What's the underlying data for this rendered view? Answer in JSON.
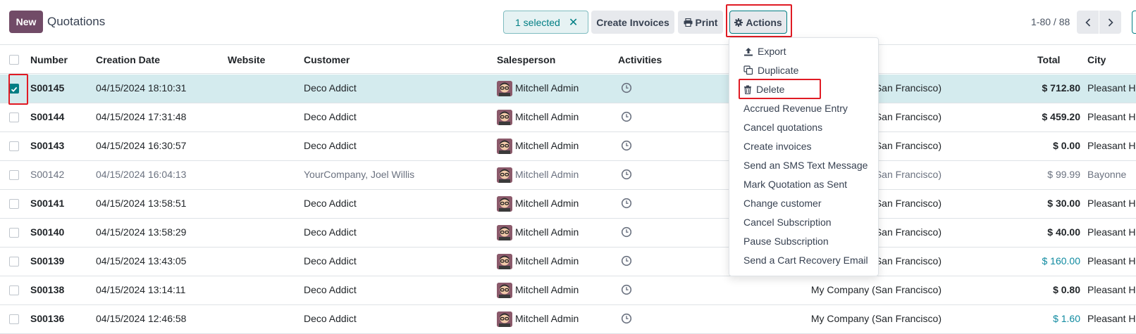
{
  "control_panel": {
    "new_label": "New",
    "title": "Quotations",
    "selection": {
      "label": "1 selected",
      "clear_symbol": "✕"
    },
    "create_invoices_label": "Create Invoices",
    "print_label": "Print",
    "actions_label": "Actions",
    "pager": "1-80 / 88"
  },
  "columns": [
    "Number",
    "Creation Date",
    "Website",
    "Customer",
    "Salesperson",
    "Activities",
    "Total",
    "City"
  ],
  "rows": [
    {
      "number": "S00145",
      "date": "04/15/2024 18:10:31",
      "customer": "Deco Addict",
      "salesperson": "Mitchell Admin",
      "company": "San Francisco)",
      "total": "$ 712.80",
      "city": "Pleasant H",
      "selected": true
    },
    {
      "number": "S00144",
      "date": "04/15/2024 17:31:48",
      "customer": "Deco Addict",
      "salesperson": "Mitchell Admin",
      "company": "San Francisco)",
      "total": "$ 459.20",
      "city": "Pleasant H"
    },
    {
      "number": "S00143",
      "date": "04/15/2024 16:30:57",
      "customer": "Deco Addict",
      "salesperson": "Mitchell Admin",
      "company": "San Francisco)",
      "total": "$ 0.00",
      "city": "Pleasant H"
    },
    {
      "number": "S00142",
      "date": "04/15/2024 16:04:13",
      "customer": "YourCompany, Joel Willis",
      "salesperson": "Mitchell Admin",
      "company": "San Francisco)",
      "total": "$ 99.99",
      "city": "Bayonne",
      "muted": true
    },
    {
      "number": "S00141",
      "date": "04/15/2024 13:58:51",
      "customer": "Deco Addict",
      "salesperson": "Mitchell Admin",
      "company": "San Francisco)",
      "total": "$ 30.00",
      "city": "Pleasant H"
    },
    {
      "number": "S00140",
      "date": "04/15/2024 13:58:29",
      "customer": "Deco Addict",
      "salesperson": "Mitchell Admin",
      "company": "San Francisco)",
      "total": "$ 40.00",
      "city": "Pleasant H"
    },
    {
      "number": "S00139",
      "date": "04/15/2024 13:43:05",
      "customer": "Deco Addict",
      "salesperson": "Mitchell Admin",
      "company": "San Francisco)",
      "total": "$ 160.00",
      "city": "Pleasant H",
      "total_link": true
    },
    {
      "number": "S00138",
      "date": "04/15/2024 13:14:11",
      "customer": "Deco Addict",
      "salesperson": "Mitchell Admin",
      "company": "My Company (San Francisco)",
      "total": "$ 0.80",
      "city": "Pleasant H"
    },
    {
      "number": "S00136",
      "date": "04/15/2024 12:46:58",
      "customer": "Deco Addict",
      "salesperson": "Mitchell Admin",
      "company": "My Company (San Francisco)",
      "total": "$ 1.60",
      "city": "Pleasant H",
      "total_link": true
    }
  ],
  "actions_menu": [
    {
      "label": "Export",
      "icon": "upload-icon"
    },
    {
      "label": "Duplicate",
      "icon": "copy-icon"
    },
    {
      "label": "Delete",
      "icon": "trash-icon"
    },
    {
      "label": "Accrued Revenue Entry"
    },
    {
      "label": "Cancel quotations"
    },
    {
      "label": "Create invoices"
    },
    {
      "label": "Send an SMS Text Message"
    },
    {
      "label": "Mark Quotation as Sent"
    },
    {
      "label": "Change customer"
    },
    {
      "label": "Cancel Subscription"
    },
    {
      "label": "Pause Subscription"
    },
    {
      "label": "Send a Cart Recovery Email"
    }
  ],
  "colors": {
    "brand": "#714b67",
    "accent": "#017e84",
    "highlight": "#e01b24",
    "selected_row": "#d4ebee",
    "link": "#0f8aa0"
  }
}
